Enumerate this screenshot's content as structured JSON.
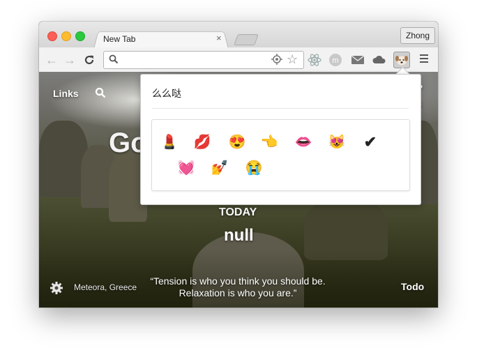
{
  "browser": {
    "tab_title": "New Tab",
    "tab_close": "×",
    "profile_name": "Zhong",
    "nav": {
      "back": "←",
      "forward": "→",
      "reload": "C"
    },
    "omnibox_value": "",
    "star_glyph": "☆",
    "extensions": [
      "react-atom-icon",
      "meteor-m-icon",
      "mail-icon",
      "cloud-icon",
      "dog-face-icon"
    ]
  },
  "newtab": {
    "links_label": "Links",
    "heading_partial": "Go",
    "today_label": "TODAY",
    "focus_value": "null",
    "location": "Meteora, Greece",
    "quote_line1": "“Tension is who you think you should be.",
    "quote_line2": "Relaxation is who you are.”",
    "todo_label": "Todo"
  },
  "popup": {
    "title": "么么哒",
    "emojis": [
      {
        "name": "lipstick-emoji",
        "glyph": "💄"
      },
      {
        "name": "kiss-mark-emoji",
        "glyph": "💋"
      },
      {
        "name": "heart-eyes-emoji",
        "glyph": "😍"
      },
      {
        "name": "pointing-hand-emoji",
        "glyph": "👈"
      },
      {
        "name": "lips-emoji",
        "glyph": "👄"
      },
      {
        "name": "heart-eyes-cat-emoji",
        "glyph": "😻"
      },
      {
        "name": "check-mark-emoji",
        "glyph": "✔"
      },
      {
        "name": "growing-heart-emoji",
        "glyph": "💓"
      },
      {
        "name": "nail-polish-emoji",
        "glyph": "💅"
      },
      {
        "name": "loudly-crying-emoji",
        "glyph": "😭"
      }
    ]
  },
  "colors": {
    "close": "#fc5f57",
    "minimize": "#fdbc2e",
    "zoom": "#2ac940"
  }
}
